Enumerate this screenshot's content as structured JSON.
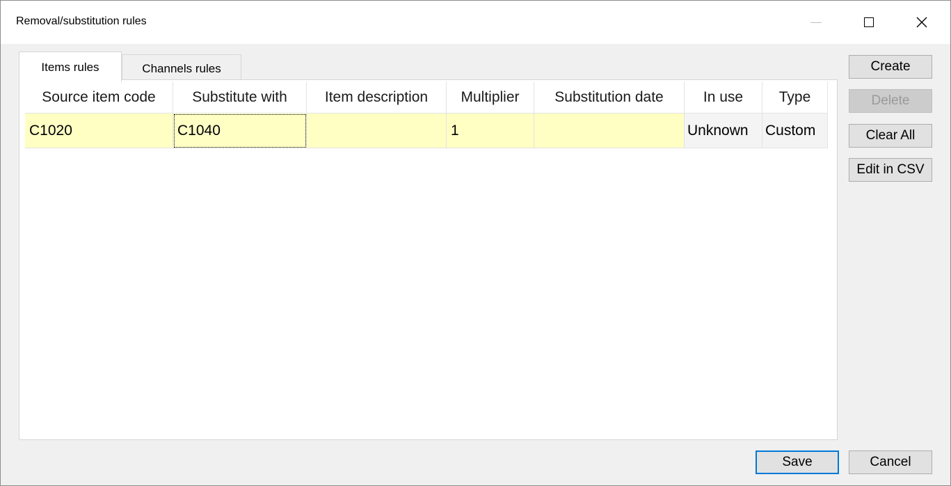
{
  "window": {
    "title": "Removal/substitution rules",
    "minimize_glyph": "—",
    "close_glyph": "✕"
  },
  "tabs": [
    {
      "label": "Items rules",
      "active": true
    },
    {
      "label": "Channels rules",
      "active": false
    }
  ],
  "grid": {
    "columns": [
      "Source item code",
      "Substitute with",
      "Item description",
      "Multiplier",
      "Substitution date",
      "In use",
      "Type"
    ],
    "rows": [
      {
        "source_item_code": "C1020",
        "substitute_with": "C1040",
        "item_description": "",
        "multiplier": "1",
        "substitution_date": "",
        "in_use": "Unknown",
        "type": "Custom"
      }
    ]
  },
  "buttons": {
    "create": "Create",
    "delete": "Delete",
    "clear_all": "Clear All",
    "edit_in_csv": "Edit in CSV",
    "save": "Save",
    "cancel": "Cancel"
  },
  "colors": {
    "editable_cell": "#ffffc4",
    "default_button_border": "#0078d7"
  },
  "icons": [
    "minimize-icon",
    "maximize-icon",
    "close-icon"
  ]
}
